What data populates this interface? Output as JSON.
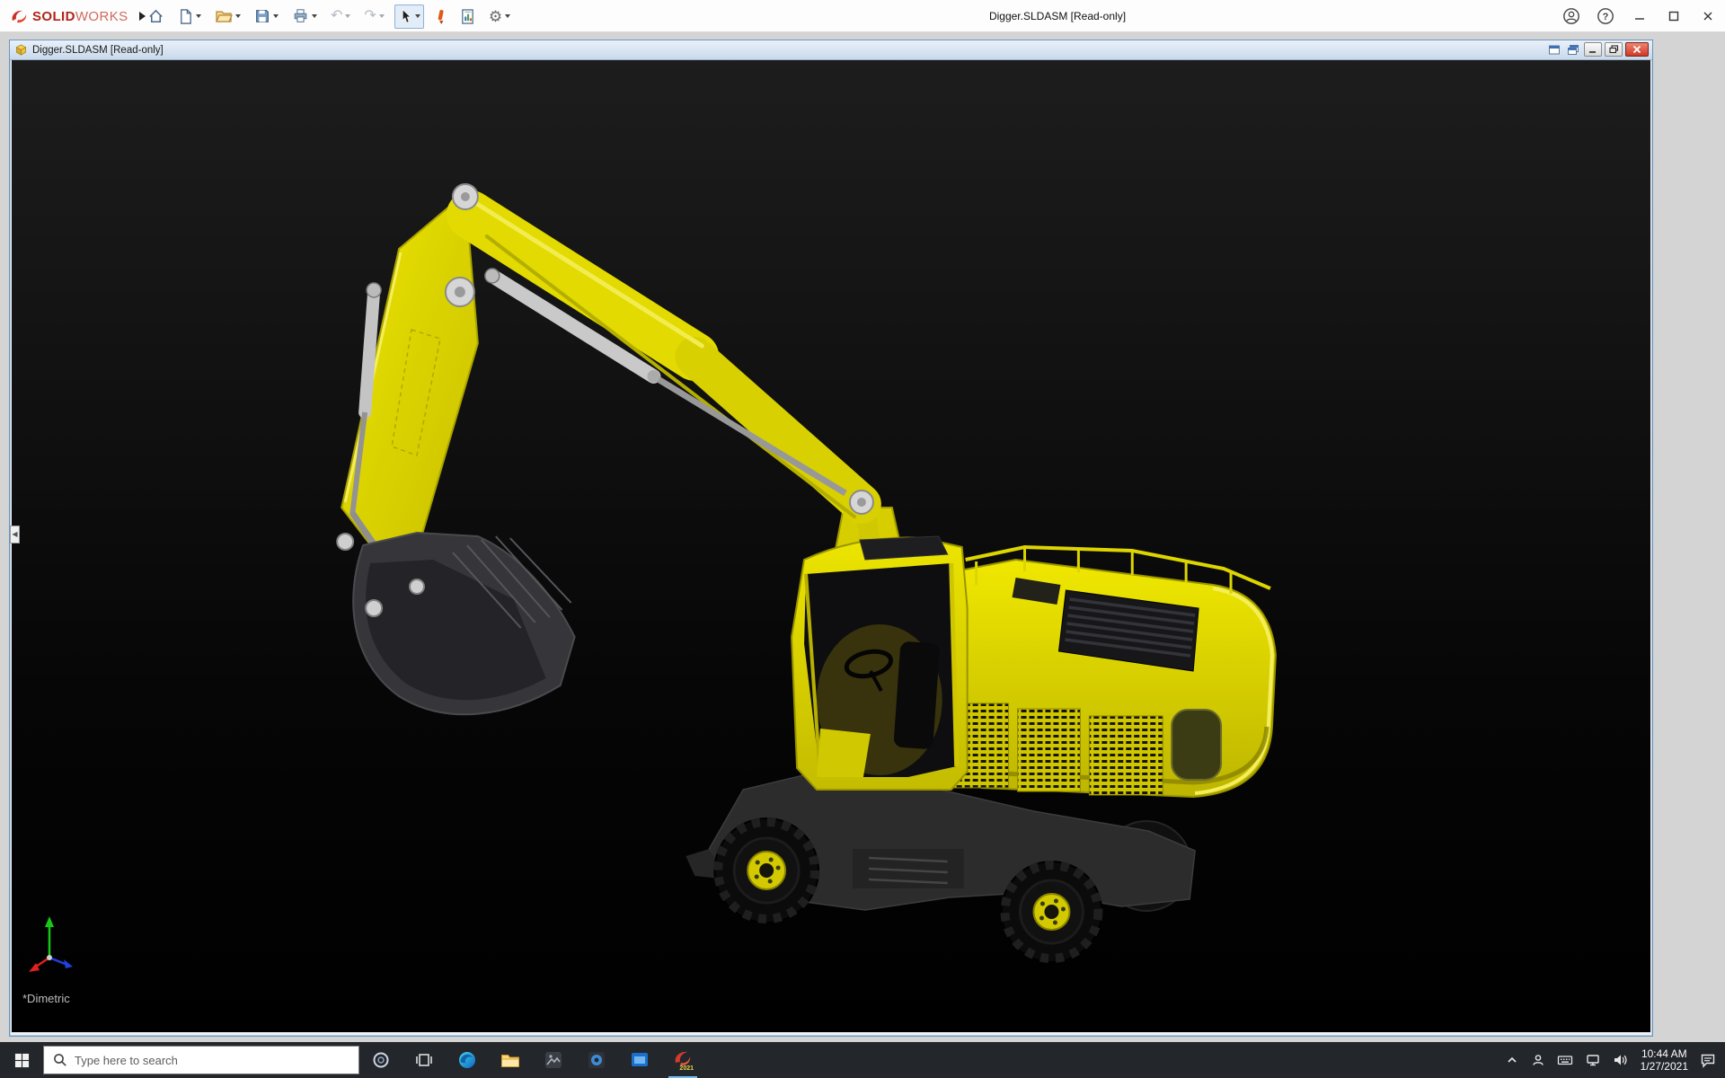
{
  "app": {
    "title": "Digger.SLDASM [Read-only]",
    "brand": {
      "solid": "SOLID",
      "works": "WORKS"
    },
    "toolbar_icons": [
      "home",
      "new-document",
      "open",
      "save",
      "print",
      "undo",
      "redo",
      "select-cursor",
      "marker-pen",
      "design-binder",
      "options-gear"
    ],
    "window_controls": [
      "account",
      "help",
      "minimize",
      "maximize",
      "close"
    ]
  },
  "document_window": {
    "title": "Digger.SLDASM [Read-only]",
    "controls": [
      "new-window",
      "cascade-window",
      "minimize",
      "restore",
      "close"
    ],
    "viewport": {
      "view_orientation": "*Dimetric",
      "model": "Yellow wheeled excavator assembly (Digger)",
      "triad_axes": [
        "X",
        "Y",
        "Z"
      ],
      "colors": {
        "model_yellow": "#e3da00",
        "background": "#0a0a0a"
      }
    }
  },
  "taskbar": {
    "search_placeholder": "Type here to search",
    "apps": [
      "start",
      "cortana",
      "task-view",
      "edge",
      "file-explorer",
      "photos-app",
      "round-app",
      "window-app",
      "solidworks-2021"
    ],
    "solidworks_year_badge": "2021",
    "tray_icons": [
      "hidden-icons-chevron",
      "person",
      "keyboard",
      "network",
      "volume"
    ],
    "clock": {
      "time": "10:44 AM",
      "date": "1/27/2021"
    }
  },
  "colors": {
    "solidworks_red": "#cf2e21",
    "taskbar_background": "#23262b",
    "doc_titlebar": "#d3e1ef"
  }
}
